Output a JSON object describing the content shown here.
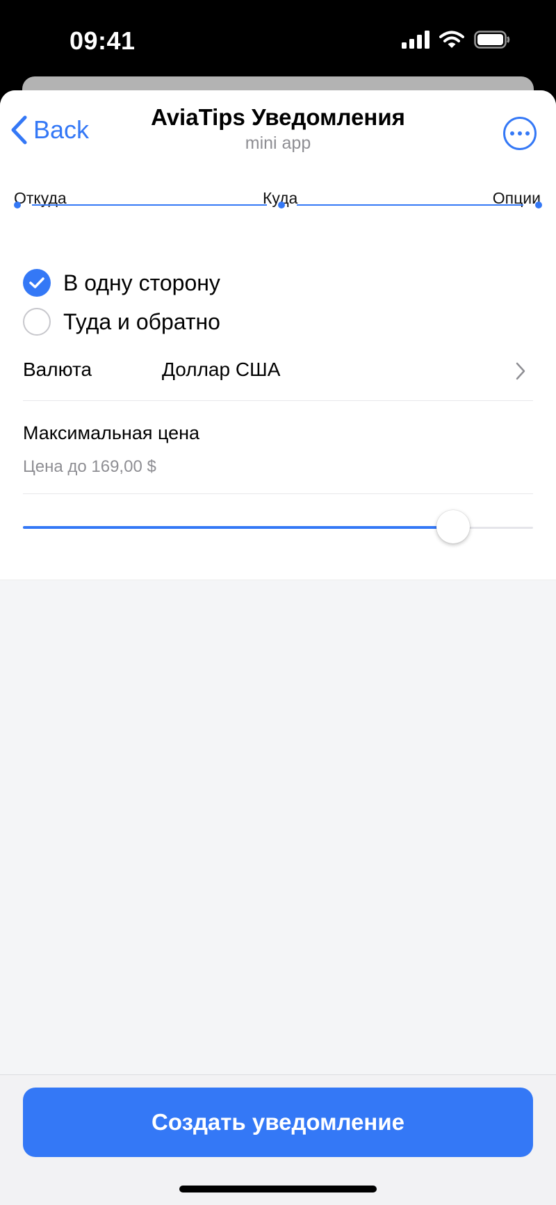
{
  "status_bar": {
    "time": "09:41"
  },
  "header": {
    "back_label": "Back",
    "title": "AviaTips Уведомления",
    "subtitle": "mini app"
  },
  "steps": [
    {
      "label": "Откуда"
    },
    {
      "label": "Куда"
    },
    {
      "label": "Опции"
    }
  ],
  "trip_type": {
    "options": [
      {
        "label": "В одну сторону",
        "selected": true
      },
      {
        "label": "Туда и обратно",
        "selected": false
      }
    ]
  },
  "currency": {
    "label": "Валюта",
    "value": "Доллар США"
  },
  "max_price": {
    "title": "Максимальная цена",
    "subtitle": "Цена до 169,00 $",
    "slider_fraction": 0.844
  },
  "cta": {
    "label": "Создать уведомление"
  },
  "colors": {
    "accent": "#3478f6",
    "background": "#f4f5f7",
    "secondary_text": "#8e8e93"
  }
}
